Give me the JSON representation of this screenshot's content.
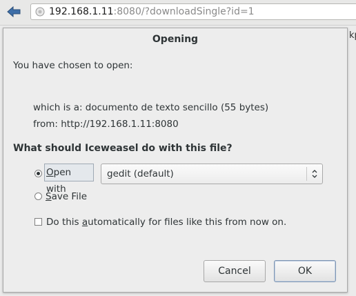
{
  "browser": {
    "url_host": "192.168.1.11",
    "url_rest": ":8080/?downloadSingle?id=1",
    "page_peek_text": "kp"
  },
  "dialog": {
    "title": "Opening",
    "intro": "You have chosen to open:",
    "which_is_a": "which is a:  documento de texto sencillo (55 bytes)",
    "from": "from:  http://192.168.1.11:8080",
    "question": "What should Iceweasel do with this file?",
    "open_with": {
      "mnemonic": "O",
      "rest": "pen with",
      "selected": true
    },
    "app_select": {
      "value": "gedit (default)"
    },
    "save_file": {
      "mnemonic": "S",
      "rest": "ave File",
      "selected": false
    },
    "auto_checkbox": {
      "pre": "Do this ",
      "mnemonic": "a",
      "post": "utomatically for files like this from now on.",
      "checked": false
    },
    "cancel_label": "Cancel",
    "ok_label": "OK"
  },
  "colors": {
    "accent_back_arrow": "#3d6ea8",
    "dialog_bg": "#ededed"
  }
}
